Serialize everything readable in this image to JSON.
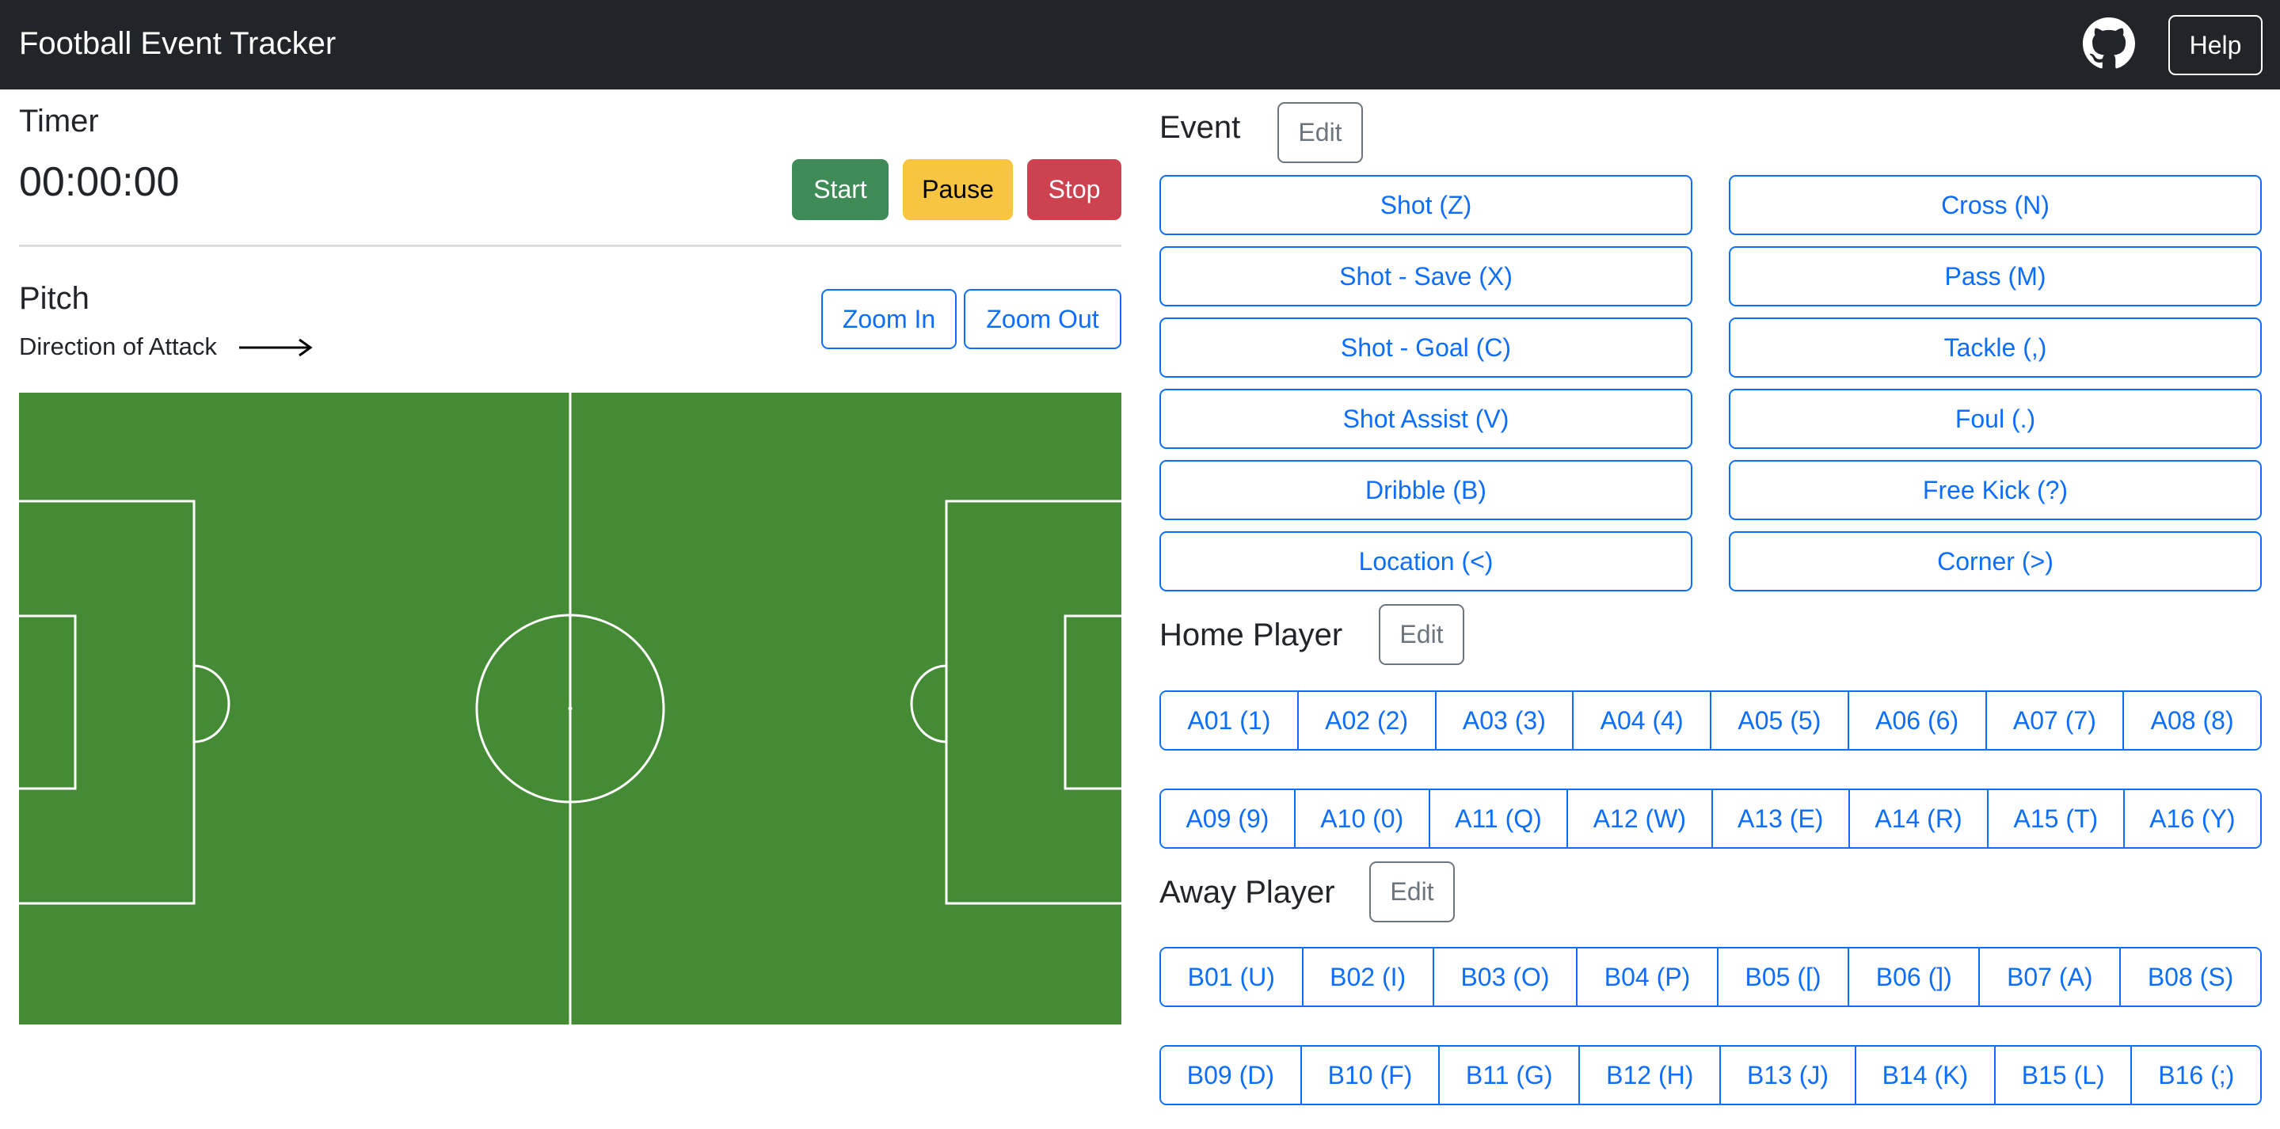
{
  "navbar": {
    "brand": "Football Event Tracker",
    "github_icon": "github-icon",
    "help_label": "Help"
  },
  "timer": {
    "heading": "Timer",
    "display": "00:00:00",
    "start_label": "Start",
    "pause_label": "Pause",
    "stop_label": "Stop",
    "colors": {
      "start": "#3f8b57",
      "pause": "#f8c542",
      "stop": "#cd424f"
    }
  },
  "pitch": {
    "heading": "Pitch",
    "direction_label": "Direction of Attack",
    "direction_icon": "arrow-right-icon",
    "zoom_in_label": "Zoom In",
    "zoom_out_label": "Zoom Out",
    "grass_color": "#458b35",
    "line_color": "#ffffff"
  },
  "events": {
    "heading": "Event",
    "edit_label": "Edit",
    "buttons": [
      "Shot (Z)",
      "Cross (N)",
      "Shot - Save (X)",
      "Pass (M)",
      "Shot - Goal (C)",
      "Tackle (,)",
      "Shot Assist (V)",
      "Foul (.)",
      "Dribble (B)",
      "Free Kick (?)",
      "Location (<)",
      "Corner (>)"
    ]
  },
  "home": {
    "heading": "Home Player",
    "edit_label": "Edit",
    "rows": [
      [
        "A01 (1)",
        "A02 (2)",
        "A03 (3)",
        "A04 (4)",
        "A05 (5)",
        "A06 (6)",
        "A07 (7)",
        "A08 (8)"
      ],
      [
        "A09 (9)",
        "A10 (0)",
        "A11 (Q)",
        "A12 (W)",
        "A13 (E)",
        "A14 (R)",
        "A15 (T)",
        "A16 (Y)"
      ]
    ]
  },
  "away": {
    "heading": "Away Player",
    "edit_label": "Edit",
    "rows": [
      [
        "B01 (U)",
        "B02 (I)",
        "B03 (O)",
        "B04 (P)",
        "B05 ([)",
        "B06 (])",
        "B07 (A)",
        "B08 (S)"
      ],
      [
        "B09 (D)",
        "B10 (F)",
        "B11 (G)",
        "B12 (H)",
        "B13 (J)",
        "B14 (K)",
        "B15 (L)",
        "B16 (;)"
      ]
    ]
  },
  "theme": {
    "primary": "#0d6efd",
    "secondary": "#6c757d",
    "navbar_bg": "#212529"
  }
}
